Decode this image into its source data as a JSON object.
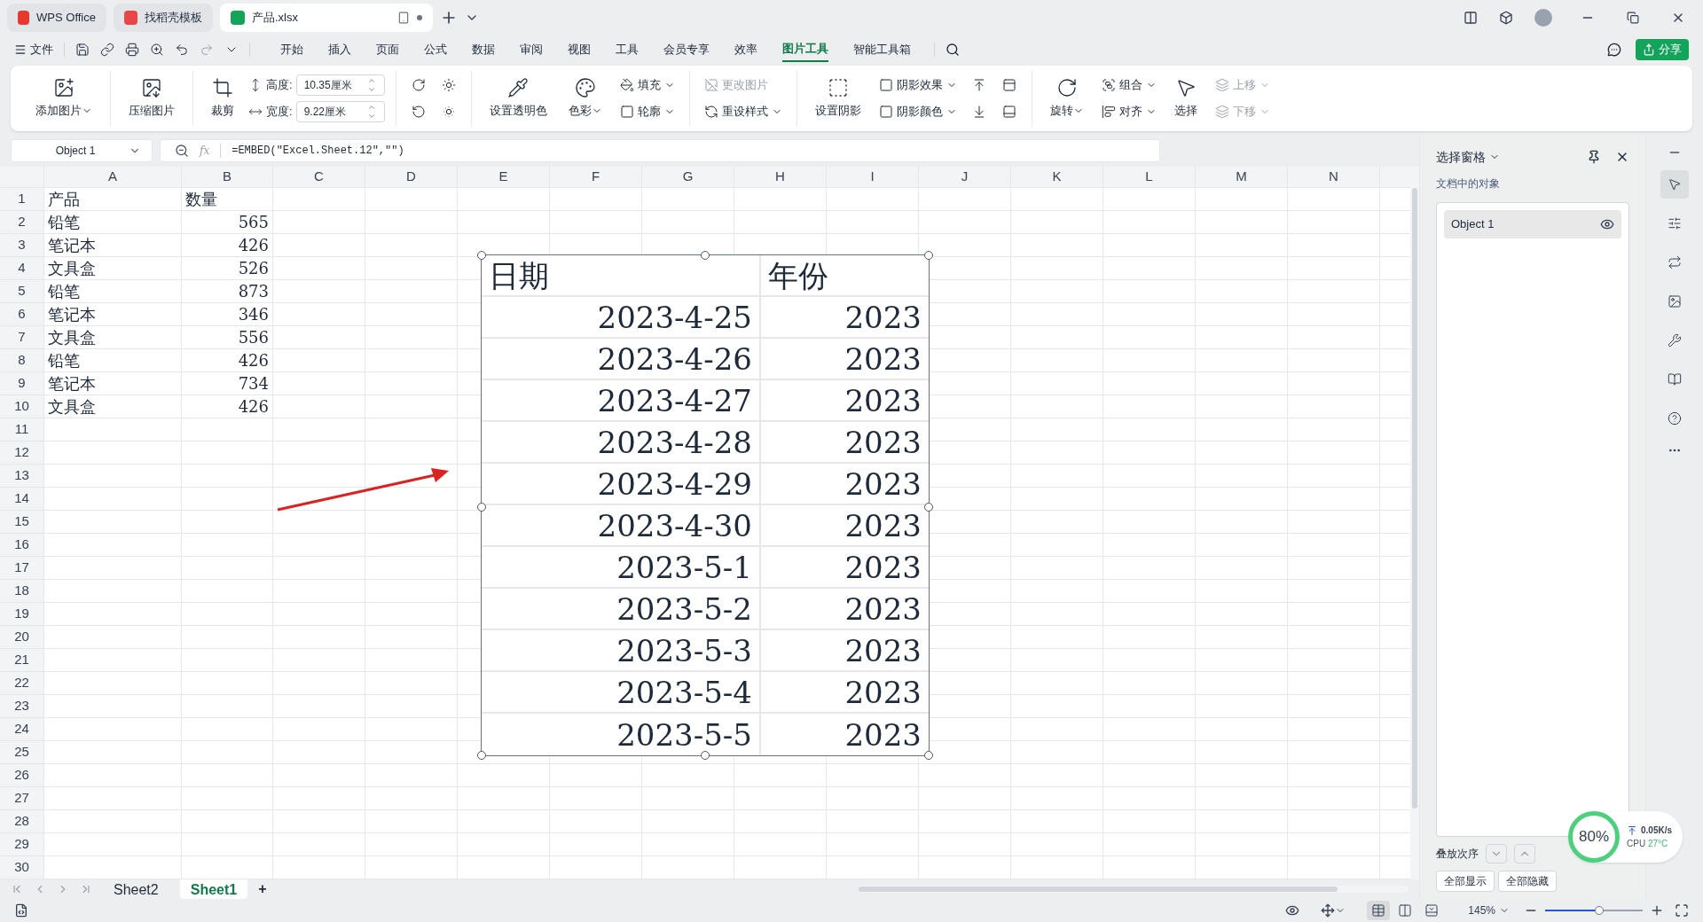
{
  "browser_tabs": [
    {
      "label": "WPS Office",
      "selected": false
    },
    {
      "label": "找稻壳模板",
      "selected": false
    },
    {
      "label": "产品.xlsx",
      "selected": true
    }
  ],
  "file_menu": "文件",
  "menu": [
    {
      "label": "开始",
      "selected": false
    },
    {
      "label": "插入",
      "selected": false
    },
    {
      "label": "页面",
      "selected": false
    },
    {
      "label": "公式",
      "selected": false
    },
    {
      "label": "数据",
      "selected": false
    },
    {
      "label": "审阅",
      "selected": false
    },
    {
      "label": "视图",
      "selected": false
    },
    {
      "label": "工具",
      "selected": false
    },
    {
      "label": "会员专享",
      "selected": false
    },
    {
      "label": "效率",
      "selected": false
    },
    {
      "label": "图片工具",
      "selected": true
    },
    {
      "label": "智能工具箱",
      "selected": false
    }
  ],
  "share_button": "分享",
  "ribbon": {
    "groups": [
      {
        "items": [
          {
            "kind": "large",
            "label": "添加图片",
            "dropdown": true,
            "disabled": false
          }
        ]
      },
      {
        "items": [
          {
            "kind": "large",
            "label": "压缩图片",
            "dropdown": false,
            "disabled": false
          }
        ]
      },
      {
        "items": [
          {
            "kind": "large",
            "label": "裁剪",
            "dropdown": false,
            "disabled": false
          },
          {
            "kind": "field",
            "label": "高度:",
            "value": "10.35厘米"
          },
          {
            "kind": "field",
            "label": "宽度:",
            "value": "9.22厘米"
          }
        ]
      },
      {
        "items": [
          {
            "kind": "icon",
            "disabled": false
          },
          {
            "kind": "icon",
            "disabled": false
          },
          {
            "kind": "icon",
            "disabled": false
          },
          {
            "kind": "icon",
            "disabled": false
          }
        ]
      },
      {
        "items": [
          {
            "kind": "large",
            "label": "设置透明色",
            "dropdown": false,
            "disabled": false
          },
          {
            "kind": "large",
            "label": "色彩",
            "dropdown": true,
            "disabled": false
          },
          {
            "kind": "small",
            "label": "填充",
            "dropdown": true,
            "disabled": false
          },
          {
            "kind": "small",
            "label": "轮廓",
            "dropdown": true,
            "disabled": false
          }
        ]
      },
      {
        "items": [
          {
            "kind": "small",
            "label": "更改图片",
            "dropdown": false,
            "disabled": true
          },
          {
            "kind": "small",
            "label": "重设样式",
            "dropdown": true,
            "disabled": false
          }
        ]
      },
      {
        "items": [
          {
            "kind": "large",
            "label": "设置阴影",
            "dropdown": false,
            "disabled": false
          },
          {
            "kind": "small",
            "label": "阴影效果",
            "dropdown": true,
            "disabled": false
          },
          {
            "kind": "small",
            "label": "阴影颜色",
            "dropdown": true,
            "disabled": false
          },
          {
            "kind": "icon",
            "disabled": false
          },
          {
            "kind": "icon",
            "disabled": false
          },
          {
            "kind": "icon",
            "disabled": false
          },
          {
            "kind": "icon",
            "disabled": false
          }
        ]
      },
      {
        "items": [
          {
            "kind": "large",
            "label": "旋转",
            "dropdown": true,
            "disabled": false
          },
          {
            "kind": "small",
            "label": "组合",
            "dropdown": true,
            "disabled": false
          },
          {
            "kind": "small",
            "label": "对齐",
            "dropdown": true,
            "disabled": false
          },
          {
            "kind": "large",
            "label": "选择",
            "dropdown": false,
            "disabled": false
          },
          {
            "kind": "small",
            "label": "上移",
            "dropdown": true,
            "disabled": true
          },
          {
            "kind": "small",
            "label": "下移",
            "dropdown": true,
            "disabled": true
          }
        ]
      }
    ]
  },
  "name_box": "Object 1",
  "fx_label": "fx",
  "formula": "=EMBED(\"Excel.Sheet.12\",\"\")",
  "columns": [
    "A",
    "B",
    "C",
    "D",
    "E",
    "F",
    "G",
    "H",
    "I",
    "J",
    "K",
    "L",
    "M",
    "N"
  ],
  "rows": [
    {
      "header": "1",
      "cells": [
        "产品",
        "数量"
      ]
    },
    {
      "header": "2",
      "cells": [
        "铅笔",
        "565"
      ]
    },
    {
      "header": "3",
      "cells": [
        "笔记本",
        "426"
      ]
    },
    {
      "header": "4",
      "cells": [
        "文具盒",
        "526"
      ]
    },
    {
      "header": "5",
      "cells": [
        "铅笔",
        "873"
      ]
    },
    {
      "header": "6",
      "cells": [
        "笔记本",
        "346"
      ]
    },
    {
      "header": "7",
      "cells": [
        "文具盒",
        "556"
      ]
    },
    {
      "header": "8",
      "cells": [
        "铅笔",
        "426"
      ]
    },
    {
      "header": "9",
      "cells": [
        "笔记本",
        "734"
      ]
    },
    {
      "header": "10",
      "cells": [
        "文具盒",
        "426"
      ]
    },
    {
      "header": "11"
    },
    {
      "header": "12"
    },
    {
      "header": "13"
    },
    {
      "header": "14"
    },
    {
      "header": "15"
    },
    {
      "header": "16"
    },
    {
      "header": "17"
    },
    {
      "header": "18"
    },
    {
      "header": "19"
    },
    {
      "header": "20"
    },
    {
      "header": "21"
    },
    {
      "header": "22"
    },
    {
      "header": "23"
    },
    {
      "header": "24"
    },
    {
      "header": "25"
    },
    {
      "header": "26"
    },
    {
      "header": "27"
    },
    {
      "header": "28"
    },
    {
      "header": "29"
    },
    {
      "header": "30"
    }
  ],
  "embedded_object": {
    "selected": true,
    "header": [
      "日期",
      "年份"
    ],
    "rows": [
      [
        "2023-4-25",
        "2023"
      ],
      [
        "2023-4-26",
        "2023"
      ],
      [
        "2023-4-27",
        "2023"
      ],
      [
        "2023-4-28",
        "2023"
      ],
      [
        "2023-4-29",
        "2023"
      ],
      [
        "2023-4-30",
        "2023"
      ],
      [
        "2023-5-1",
        "2023"
      ],
      [
        "2023-5-2",
        "2023"
      ],
      [
        "2023-5-3",
        "2023"
      ],
      [
        "2023-5-4",
        "2023"
      ],
      [
        "2023-5-5",
        "2023"
      ]
    ]
  },
  "selection_pane": {
    "title": "选择窗格",
    "subtitle": "文档中的对象",
    "objects": [
      {
        "name": "Object 1",
        "visible": true,
        "selected": true
      }
    ],
    "order_label": "叠放次序",
    "buttons": [
      "全部显示",
      "全部隐藏"
    ]
  },
  "side_tools": [
    {
      "selected": true
    },
    {
      "selected": false
    },
    {
      "selected": false
    },
    {
      "selected": false
    },
    {
      "selected": false
    },
    {
      "selected": false
    },
    {
      "selected": false
    }
  ],
  "sheet_tabs": [
    {
      "label": "Sheet2",
      "selected": false
    },
    {
      "label": "Sheet1",
      "selected": true
    }
  ],
  "add_sheet": "+",
  "status_bar": {
    "views": [
      {
        "selected": true
      },
      {
        "selected": false
      },
      {
        "selected": false
      }
    ],
    "zoom": "145%",
    "zoom_slider": {
      "level": 0.55
    }
  },
  "system_monitor": {
    "usage": "80%",
    "speed": "0.05K/s",
    "cpu_label": "CPU",
    "temperature": "27°C"
  }
}
